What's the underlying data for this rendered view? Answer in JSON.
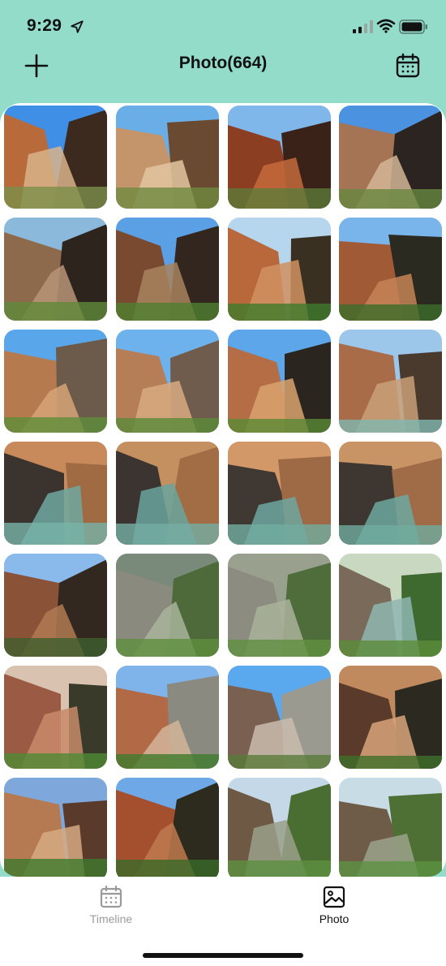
{
  "status_bar": {
    "time": "9:29"
  },
  "header": {
    "title": "Photo(664)",
    "left_icon": "plus-icon",
    "right_icon": "calendar-icon"
  },
  "colors": {
    "header_bg": "#93dcc9",
    "text": "#111111",
    "tab_inactive": "#9a9a9a",
    "tab_active": "#111111"
  },
  "photos": [
    {
      "sky": "#3f8fe6",
      "a": "#b86a3a",
      "b": "#3d2a1e",
      "c": "#d8b38a",
      "g": "#7a8f4a"
    },
    {
      "sky": "#6aaee8",
      "a": "#c4946a",
      "b": "#6b4a32",
      "c": "#e2c6a0",
      "g": "#6f8a3e"
    },
    {
      "sky": "#7fb7ea",
      "a": "#8c3e22",
      "b": "#3a2218",
      "c": "#c46a3c",
      "g": "#5e7a3a"
    },
    {
      "sky": "#4b92e0",
      "a": "#a57454",
      "b": "#2c2420",
      "c": "#d2b698",
      "g": "#66873e"
    },
    {
      "sky": "#8bb9dc",
      "a": "#8e6a4c",
      "b": "#2d241e",
      "c": "#b89478",
      "g": "#5f8a3a"
    },
    {
      "sky": "#5ba0e4",
      "a": "#7a4a30",
      "b": "#33261f",
      "c": "#a8825e",
      "g": "#4f7f2f"
    },
    {
      "sky": "#b6d6ee",
      "a": "#b9683c",
      "b": "#3a3022",
      "c": "#d09060",
      "g": "#3f7a2c"
    },
    {
      "sky": "#79b4ea",
      "a": "#a05a36",
      "b": "#2b2a20",
      "c": "#c48456",
      "g": "#3c6d2a"
    },
    {
      "sky": "#5aa6ea",
      "a": "#b57a4e",
      "b": "#6c5a4a",
      "c": "#d7a578",
      "g": "#5e8d3a"
    },
    {
      "sky": "#6db2ec",
      "a": "#b57e56",
      "b": "#6f5c4c",
      "c": "#d8aa80",
      "g": "#5a8b38"
    },
    {
      "sky": "#5ea6ea",
      "a": "#b46d45",
      "b": "#2b2520",
      "c": "#d9a36f",
      "g": "#5a8a35"
    },
    {
      "sky": "#9cc7ea",
      "a": "#a96c48",
      "b": "#4a3a2e",
      "c": "#c9a078",
      "g": "#7fb8b0"
    },
    {
      "sky": "#c88a5a",
      "a": "#3b342e",
      "b": "#a06a42",
      "c": "#6fa8a0",
      "g": "#78b3a8"
    },
    {
      "sky": "#c49060",
      "a": "#3b3430",
      "b": "#a26c44",
      "c": "#6aa49c",
      "g": "#74aea4"
    },
    {
      "sky": "#d29868",
      "a": "#403832",
      "b": "#9e6a46",
      "c": "#6ea6a0",
      "g": "#72ad9f"
    },
    {
      "sky": "#c89466",
      "a": "#3e3630",
      "b": "#a06c48",
      "c": "#6ca8a0",
      "g": "#70ab9d"
    },
    {
      "sky": "#8ab9ec",
      "a": "#8a5236",
      "b": "#332820",
      "c": "#b07a52",
      "g": "#3e5f2e"
    },
    {
      "sky": "#7a8a7a",
      "a": "#8a8a7e",
      "b": "#4e6a3a",
      "c": "#a8b49a",
      "g": "#5f8f3f"
    },
    {
      "sky": "#9aa08e",
      "a": "#8c8c80",
      "b": "#4f6d3a",
      "c": "#a9b29a",
      "g": "#609040"
    },
    {
      "sky": "#c9d8c0",
      "a": "#7a6a5a",
      "b": "#3e6a30",
      "c": "#8fb6b0",
      "g": "#5b8d3a"
    },
    {
      "sky": "#d9c2b0",
      "a": "#9a5a44",
      "b": "#3a3a2a",
      "c": "#c88b6a",
      "g": "#4f8a34"
    },
    {
      "sky": "#7fb4ea",
      "a": "#b26a46",
      "b": "#8a8a80",
      "c": "#d4b49a",
      "g": "#3e7a2c"
    },
    {
      "sky": "#5aa8ee",
      "a": "#7a6050",
      "b": "#9a9a90",
      "c": "#c9bcae",
      "g": "#5a7a3a"
    },
    {
      "sky": "#c08a5e",
      "a": "#5a3a2a",
      "b": "#2c2a20",
      "c": "#d8a57a",
      "g": "#3f6f2a"
    },
    {
      "sky": "#7ea8dc",
      "a": "#b67a52",
      "b": "#5a3a2a",
      "c": "#d6aa82",
      "g": "#3f7a2e"
    },
    {
      "sky": "#6fa8e6",
      "a": "#a4502e",
      "b": "#2d2a1e",
      "c": "#c07a4e",
      "g": "#3a6a28"
    },
    {
      "sky": "#c5d8e8",
      "a": "#6e5a44",
      "b": "#4a6e32",
      "c": "#9aa08a",
      "g": "#5b9040"
    },
    {
      "sky": "#c8dce6",
      "a": "#6f5c48",
      "b": "#4e7034",
      "c": "#9ca28c",
      "g": "#5d9242"
    }
  ],
  "tabbar": {
    "tabs": [
      {
        "label": "Timeline",
        "icon": "calendar-icon",
        "active": false
      },
      {
        "label": "Photo",
        "icon": "image-icon",
        "active": true
      }
    ]
  }
}
